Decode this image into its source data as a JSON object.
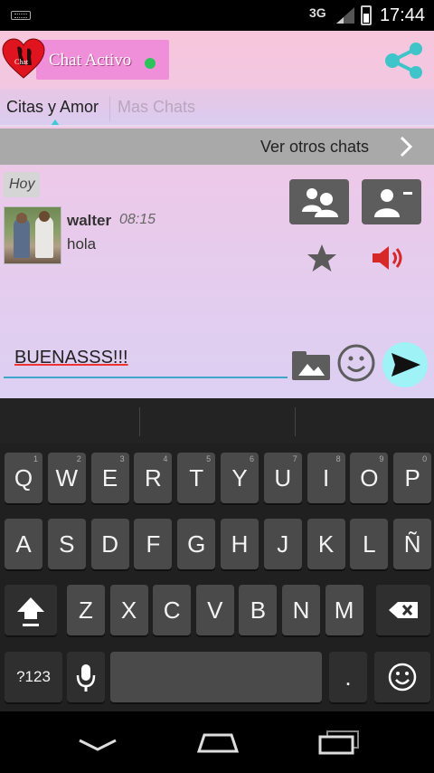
{
  "status_bar": {
    "network": "3G",
    "time": "17:44"
  },
  "header": {
    "logo_text": "Chat",
    "title": "Chat Activo",
    "online_color": "#2cc45a"
  },
  "tabs": [
    {
      "label": "Citas y Amor",
      "active": true
    },
    {
      "label": "Mas Chats",
      "active": false
    }
  ],
  "other_chats": {
    "label": "Ver otros chats"
  },
  "chat": {
    "date_label": "Hoy",
    "messages": [
      {
        "user": "walter",
        "time": "08:15",
        "text": "hola"
      }
    ]
  },
  "composer": {
    "value": "BUENASSS!!!"
  },
  "keyboard": {
    "row1": [
      {
        "k": "Q",
        "n": "1"
      },
      {
        "k": "W",
        "n": "2"
      },
      {
        "k": "E",
        "n": "3"
      },
      {
        "k": "R",
        "n": "4"
      },
      {
        "k": "T",
        "n": "5"
      },
      {
        "k": "Y",
        "n": "6"
      },
      {
        "k": "U",
        "n": "7"
      },
      {
        "k": "I",
        "n": "8"
      },
      {
        "k": "O",
        "n": "9"
      },
      {
        "k": "P",
        "n": "0"
      }
    ],
    "row2": [
      "A",
      "S",
      "D",
      "F",
      "G",
      "H",
      "J",
      "K",
      "L",
      "Ñ"
    ],
    "row3": [
      "Z",
      "X",
      "C",
      "V",
      "B",
      "N",
      "M"
    ],
    "symbols_key": "?123",
    "period_key": "."
  },
  "colors": {
    "accent": "#3ea6c9",
    "send_bg": "#9ff2f5",
    "title_pill": "#f08fd9",
    "volume": "#d62828"
  }
}
